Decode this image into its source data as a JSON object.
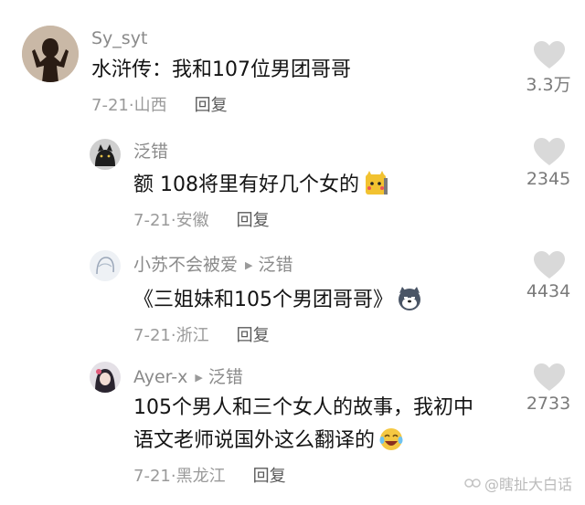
{
  "comments": [
    {
      "user": "Sy_syt",
      "reply_to": "",
      "lines": [
        "水浒传：我和107位男团哥哥"
      ],
      "date": "7-21",
      "location": "山西",
      "reply_label": "回复",
      "likes": "3.3万"
    },
    {
      "user": "泛错",
      "reply_to": "",
      "lines": [
        "额  108将里有好几个女的"
      ],
      "date": "7-21",
      "location": "安徽",
      "reply_label": "回复",
      "likes": "2345",
      "emoji": "pikachu-emoji"
    },
    {
      "user": "小苏不会被爱",
      "reply_to": "泛错",
      "lines": [
        "《三姐妹和105个男团哥哥》"
      ],
      "date": "7-21",
      "location": "浙江",
      "reply_label": "回复",
      "likes": "4434",
      "emoji": "husky-emoji"
    },
    {
      "user": "Ayer-x",
      "reply_to": "泛错",
      "lines": [
        "105个男人和三个女人的故事，我初中",
        "语文老师说国外这么翻译的"
      ],
      "date": "7-21",
      "location": "黑龙江",
      "reply_label": "回复",
      "likes": "2733",
      "emoji": "laugh-cry-emoji"
    }
  ],
  "watermark": "@瞎扯大白话",
  "colors": {
    "heart": "#d9d9d9",
    "meta": "#9a9a9a"
  }
}
